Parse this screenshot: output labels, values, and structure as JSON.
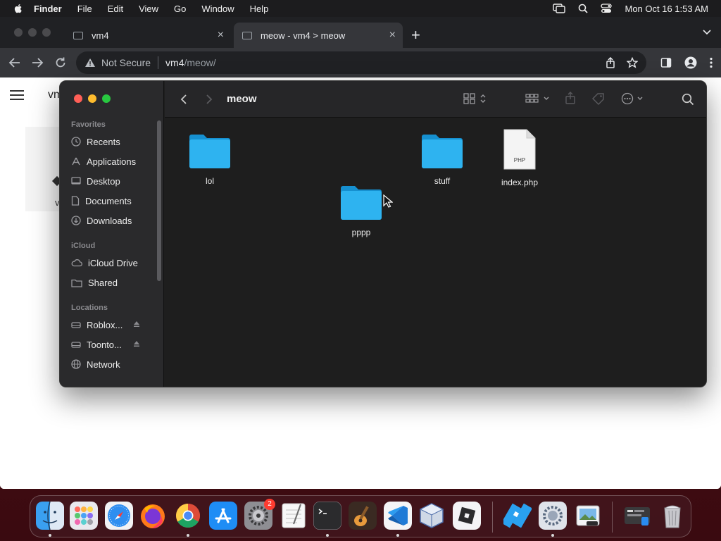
{
  "menubar": {
    "app": "Finder",
    "items": [
      "File",
      "Edit",
      "View",
      "Go",
      "Window",
      "Help"
    ],
    "clock": "Mon Oct 16  1:53 AM"
  },
  "browser": {
    "tabs": [
      {
        "title": "vm4"
      },
      {
        "title": "meow - vm4 > meow"
      }
    ],
    "address": {
      "security": "Not Secure",
      "host": "vm4",
      "path": "/meow/"
    },
    "page": {
      "brand": "vm",
      "fragment": "v"
    }
  },
  "finder": {
    "title": "meow",
    "sidebar": {
      "favorites_header": "Favorites",
      "favorites": [
        "Recents",
        "Applications",
        "Desktop",
        "Documents",
        "Downloads"
      ],
      "icloud_header": "iCloud",
      "icloud": [
        "iCloud Drive",
        "Shared"
      ],
      "locations_header": "Locations",
      "locations": [
        "Roblox...",
        "Toonto...",
        "Network"
      ]
    },
    "items": [
      {
        "name": "lol",
        "kind": "folder"
      },
      {
        "name": "stuff",
        "kind": "folder"
      },
      {
        "name": "index.php",
        "kind": "php-file",
        "badge": "PHP"
      },
      {
        "name": "pppp",
        "kind": "folder"
      }
    ]
  },
  "dock": {
    "apps": [
      "finder",
      "launchpad",
      "safari",
      "firefox",
      "chrome",
      "app-store",
      "system-settings",
      "textedit",
      "terminal",
      "garageband",
      "vscode",
      "virtualbox",
      "roblox",
      "roblox-studio",
      "settings-utility",
      "preview",
      "downloads-stack",
      "trash"
    ],
    "system_settings_badge": "2"
  },
  "colors": {
    "folder": "#1fa7e8",
    "traffic_red": "#ff5f57",
    "traffic_yellow": "#febc2e",
    "traffic_green": "#28c840"
  }
}
